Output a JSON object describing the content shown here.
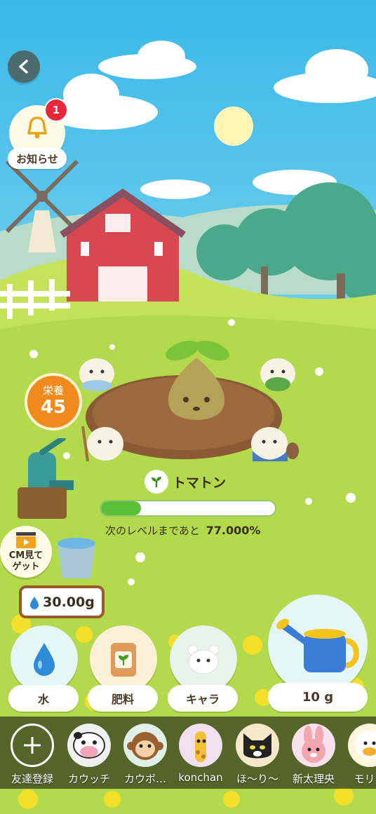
{
  "notice": {
    "label": "お知らせ",
    "badge": "1"
  },
  "nutrition": {
    "label": "栄養",
    "value": "45"
  },
  "plant": {
    "name": "トマトン",
    "progress_fraction": 0.23,
    "next_level_label": "次のレベルまであと",
    "next_level_pct": "77.000%"
  },
  "cm": {
    "label_line1": "CM見て",
    "label_line2": "ゲット"
  },
  "water_amount": "30.00g",
  "actions": [
    {
      "label": "水",
      "icon": "water-drop-icon"
    },
    {
      "label": "肥料",
      "icon": "fertilizer-bag-icon"
    },
    {
      "label": "キャラ",
      "icon": "hamster-face-icon"
    }
  ],
  "watering": {
    "label": "10 g",
    "icon": "watering-can-icon"
  },
  "friends": [
    {
      "name": "友達登録",
      "icon": "plus-icon"
    },
    {
      "name": "カウッチ",
      "icon": "cow-avatar"
    },
    {
      "name": "カウボ…",
      "icon": "monkey-avatar"
    },
    {
      "name": "konchan",
      "icon": "giraffe-avatar"
    },
    {
      "name": "ほ〜り〜",
      "icon": "black-cat-avatar"
    },
    {
      "name": "新太理央",
      "icon": "rabbit-avatar"
    },
    {
      "name": "モリッ",
      "icon": "duck-avatar"
    }
  ],
  "colors": {
    "sky": "#5ec8ec",
    "grass": "#a9d64a",
    "accent_orange": "#f08a1c",
    "progress": "#5bbf3a",
    "bottom_bar": "#4f5a2a"
  }
}
